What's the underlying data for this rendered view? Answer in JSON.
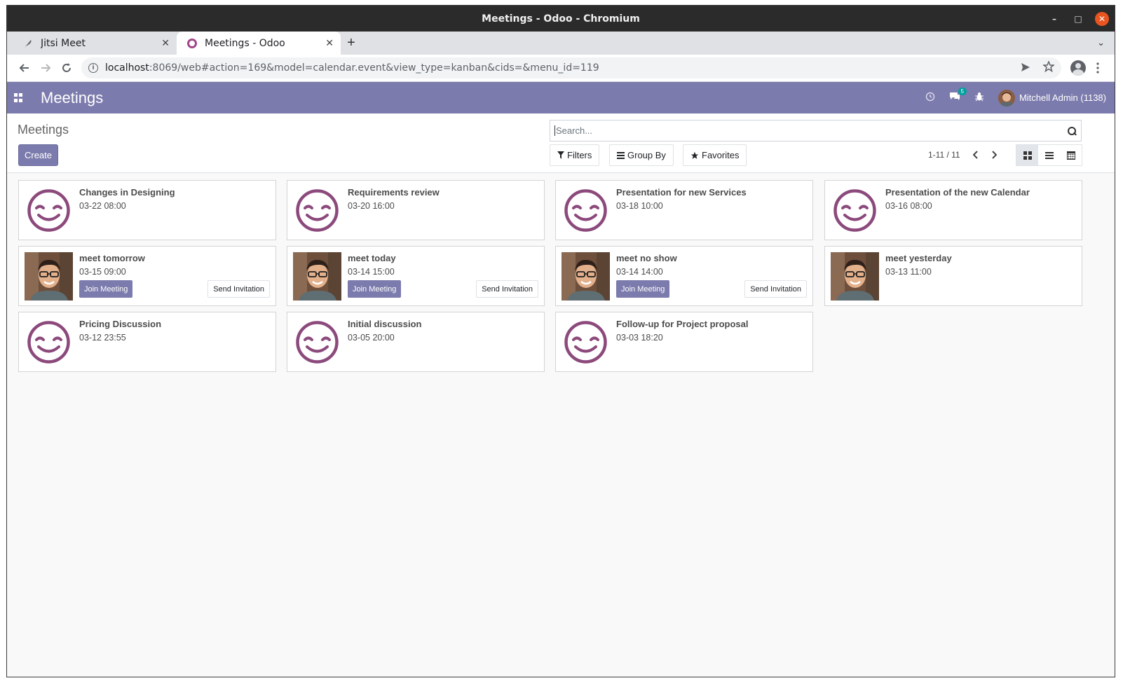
{
  "window": {
    "title": "Meetings - Odoo - Chromium",
    "controls": {
      "minimize": "–",
      "maximize": "□",
      "close": "✕"
    }
  },
  "tabs": [
    {
      "title": "Jitsi Meet",
      "close": "✕"
    },
    {
      "title": "Meetings - Odoo",
      "close": "✕"
    }
  ],
  "new_tab": "+",
  "tab_menu": "⌄",
  "address": {
    "url_host": "localhost",
    "url_rest": ":8069/web#action=169&model=calendar.event&view_type=kanban&cids=&menu_id=119"
  },
  "navbar": {
    "brand": "Meetings",
    "messages_count": "5",
    "user": "Mitchell Admin (1138)",
    "color": "#7c7bad"
  },
  "control_panel": {
    "breadcrumb": "Meetings",
    "create_label": "Create",
    "search_placeholder": "Search...",
    "filters_label": "Filters",
    "groupby_label": "Group By",
    "favorites_label": "Favorites",
    "pager": "1-11 / 11"
  },
  "cards": [
    {
      "title": "Changes in Designing",
      "date": "03-22 08:00",
      "avatar": "smiley",
      "buttons": false
    },
    {
      "title": "Requirements review",
      "date": "03-20 16:00",
      "avatar": "smiley",
      "buttons": false
    },
    {
      "title": "Presentation for new Services",
      "date": "03-18 10:00",
      "avatar": "smiley",
      "buttons": false
    },
    {
      "title": "Presentation of the new Calendar",
      "date": "03-16 08:00",
      "avatar": "smiley",
      "buttons": false
    },
    {
      "title": "meet tomorrow",
      "date": "03-15 09:00",
      "avatar": "photo",
      "buttons": true
    },
    {
      "title": "meet today",
      "date": "03-14 15:00",
      "avatar": "photo",
      "buttons": true
    },
    {
      "title": "meet no show",
      "date": "03-14 14:00",
      "avatar": "photo",
      "buttons": true
    },
    {
      "title": "meet yesterday",
      "date": "03-13 11:00",
      "avatar": "photo",
      "buttons": false
    },
    {
      "title": "Pricing Discussion",
      "date": "03-12 23:55",
      "avatar": "smiley",
      "buttons": false
    },
    {
      "title": "Initial discussion",
      "date": "03-05 20:00",
      "avatar": "smiley",
      "buttons": false
    },
    {
      "title": "Follow-up for Project proposal",
      "date": "03-03 18:20",
      "avatar": "smiley",
      "buttons": false
    }
  ],
  "card_buttons": {
    "join": "Join Meeting",
    "invite": "Send Invitation"
  },
  "colors": {
    "smiley": "#8c4a7c",
    "primary": "#7c7bad"
  }
}
